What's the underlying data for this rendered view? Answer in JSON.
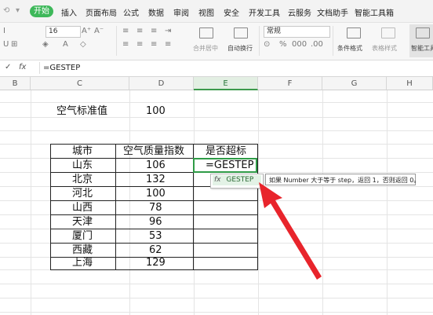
{
  "menu": {
    "active": "开始",
    "items": [
      "插入",
      "页面布局",
      "公式",
      "数据",
      "审阅",
      "视图",
      "安全",
      "开发工具",
      "云服务",
      "文档助手",
      "智能工具箱"
    ]
  },
  "ribbon": {
    "font_size": "16",
    "number_format": "常规",
    "merge_center": "合并居中",
    "wrap_text": "自动换行",
    "conditional_format": "条件格式",
    "table_style": "表格样式",
    "smart_tools": "智能工具"
  },
  "formula_bar": {
    "fx": "fx",
    "text": "=GESTEP"
  },
  "columns": [
    "B",
    "C",
    "D",
    "E",
    "F",
    "G",
    "H"
  ],
  "sheet": {
    "standard_label": "空气标准值",
    "standard_value": "100",
    "table": {
      "headers": [
        "城市",
        "空气质量指数",
        "是否超标"
      ],
      "rows": [
        {
          "city": "山东",
          "aqi": "106",
          "over": "=GESTEP"
        },
        {
          "city": "北京",
          "aqi": "132",
          "over": ""
        },
        {
          "city": "河北",
          "aqi": "100",
          "over": ""
        },
        {
          "city": "山西",
          "aqi": "78",
          "over": ""
        },
        {
          "city": "天津",
          "aqi": "96",
          "over": ""
        },
        {
          "city": "厦门",
          "aqi": "53",
          "over": ""
        },
        {
          "city": "西藏",
          "aqi": "62",
          "over": ""
        },
        {
          "city": "上海",
          "aqi": "129",
          "over": ""
        }
      ]
    }
  },
  "autocomplete": {
    "fx": "fx",
    "item": "GESTEP"
  },
  "tooltip": {
    "text": "如果 Number 大于等于 step，返回 1，否则返回 0。"
  },
  "colors": {
    "accent": "#3eb85a",
    "arrow": "#e8242b",
    "selection": "#2f9b47"
  }
}
